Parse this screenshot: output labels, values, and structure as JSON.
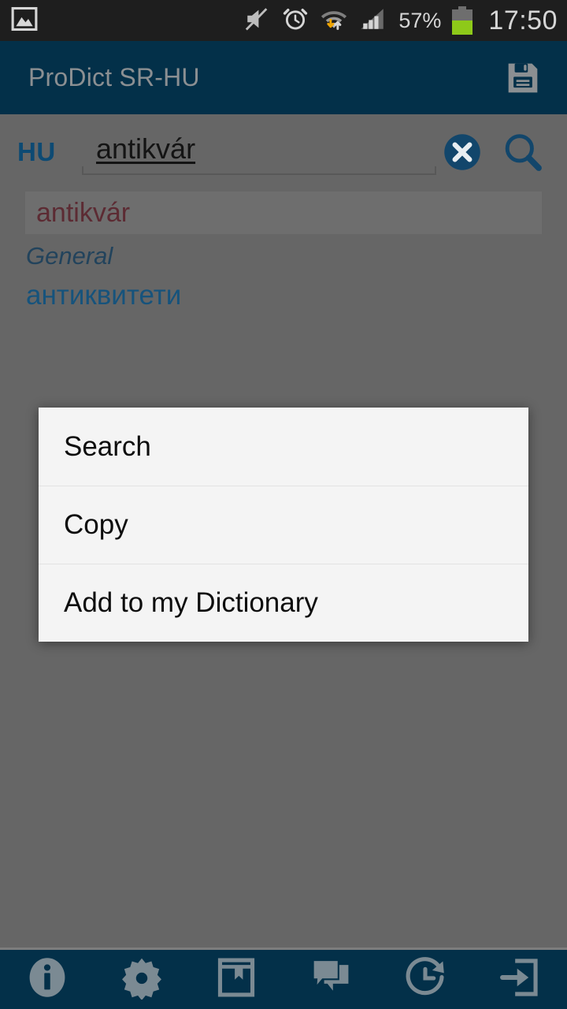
{
  "status_bar": {
    "notification_icon": "image-icon",
    "icons": [
      "mute-icon",
      "alarm-icon",
      "wifi-transfer-icon",
      "signal-icon"
    ],
    "battery_percent": "57%",
    "battery_level": 57,
    "time": "17:50",
    "background_color": "#1e1e1e",
    "text_color": "#d6d6d6",
    "battery_fill_color": "#8ec919"
  },
  "app_bar": {
    "title": "ProDict SR-HU",
    "save_icon": "save-icon",
    "background_color": "#033049",
    "title_color": "#8b8f92"
  },
  "search": {
    "language_label": "HU",
    "value": "antikvár",
    "placeholder": "",
    "clear_icon": "clear-circle-icon",
    "search_icon": "search-icon",
    "accent_color": "#0d4a73"
  },
  "results": [
    {
      "headword": "antikvár",
      "category": "General",
      "translation": "антиквитети",
      "headword_color": "#5c2b33",
      "category_color": "#22435c",
      "translation_color": "#16537c"
    }
  ],
  "context_menu": {
    "items": [
      {
        "label": "Search"
      },
      {
        "label": "Copy"
      },
      {
        "label": "Add to my Dictionary"
      }
    ],
    "background_color": "#f4f4f4",
    "text_color": "#0d0d0d"
  },
  "bottom_nav": {
    "background_color": "#033049",
    "icon_color": "#7b8a93",
    "items": [
      {
        "icon": "info-icon"
      },
      {
        "icon": "settings-gear-icon"
      },
      {
        "icon": "book-bookmark-icon"
      },
      {
        "icon": "chat-bubbles-icon"
      },
      {
        "icon": "history-icon"
      },
      {
        "icon": "exit-icon"
      }
    ]
  },
  "overlay": {
    "scrim_color": "#666666"
  }
}
